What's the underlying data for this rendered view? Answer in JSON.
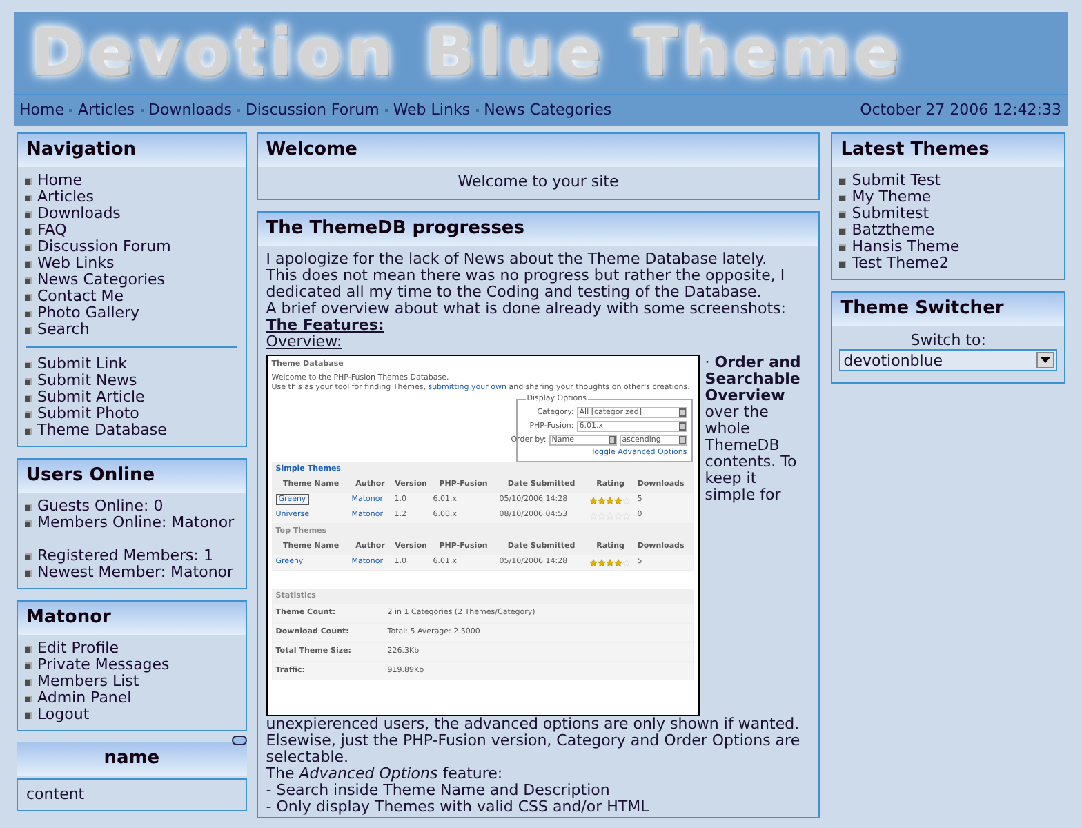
{
  "header": {
    "title": "Devotion Blue Theme",
    "nav": [
      "Home",
      "Articles",
      "Downloads",
      "Discussion Forum",
      "Web Links",
      "News Categories"
    ],
    "datetime": "October 27 2006 12:42:33"
  },
  "left_sidebar": [
    {
      "kind": "menu",
      "title": "Navigation",
      "groups": [
        [
          "Home",
          "Articles",
          "Downloads",
          "FAQ",
          "Discussion Forum",
          "Web Links",
          "News Categories",
          "Contact Me",
          "Photo Gallery",
          "Search"
        ],
        [
          "Submit Link",
          "Submit News",
          "Submit Article",
          "Submit Photo",
          "Theme Database"
        ]
      ],
      "divider": true
    },
    {
      "kind": "menu",
      "title": "Users Online",
      "groups": [
        [
          "Guests Online: 0",
          "Members Online: Matonor"
        ],
        [
          "Registered Members: 1",
          "Newest Member: Matonor"
        ]
      ],
      "divider": false
    },
    {
      "kind": "menu",
      "title": "Matonor",
      "groups": [
        [
          "Edit Profile",
          "Private Messages",
          "Members List",
          "Admin Panel",
          "Logout"
        ]
      ]
    },
    {
      "kind": "collapsible",
      "title": "name",
      "content": "content"
    }
  ],
  "welcome": {
    "title": "Welcome",
    "text": "Welcome to your site"
  },
  "news": {
    "title": "The ThemeDB progresses",
    "intro": [
      "I apologize for the lack of News about the Theme Database lately.",
      "This does not mean there was no progress but rather the opposite, I dedicated all my time to the Coding and testing of the Database.",
      "A brief overview about what is done already with some screenshots:"
    ],
    "features_heading": "The Features:",
    "overview_heading": "Overview:",
    "screenshot": {
      "title": "Theme Database",
      "welcome": "Welcome to the PHP-Fusion Themes Database.",
      "use_before": "Use this as your tool for finding Themes,",
      "use_link": "submitting your own",
      "use_after": "and sharing your thoughts on other's creations.",
      "options": {
        "legend": "Display Options",
        "fields": [
          {
            "label": "Category:",
            "values": [
              "All [categorized]"
            ]
          },
          {
            "label": "PHP-Fusion:",
            "values": [
              "6.01.x"
            ]
          },
          {
            "label": "Order by:",
            "values": [
              "Name",
              "ascending"
            ]
          }
        ],
        "toggle": "Toggle Advanced Options"
      },
      "tables": [
        {
          "title": "Simple Themes",
          "title_link": true,
          "columns": [
            "Theme Name",
            "Author",
            "Version",
            "PHP-Fusion",
            "Date Submitted",
            "Rating",
            "Downloads"
          ],
          "rows": [
            {
              "name": "Greeny",
              "focused": true,
              "author": "Matonor",
              "version": "1.0",
              "fusion": "6.01.x",
              "date": "05/10/2006 14:28",
              "stars": 4,
              "downloads": "5"
            },
            {
              "name": "Universe",
              "focused": false,
              "author": "Matonor",
              "version": "1.2",
              "fusion": "6.00.x",
              "date": "08/10/2006 04:53",
              "stars": 0,
              "downloads": "0"
            }
          ]
        },
        {
          "title": "Top Themes",
          "title_link": false,
          "columns": [
            "Theme Name",
            "Author",
            "Version",
            "PHP-Fusion",
            "Date Submitted",
            "Rating",
            "Downloads"
          ],
          "rows": [
            {
              "name": "Greeny",
              "focused": false,
              "author": "Matonor",
              "version": "1.0",
              "fusion": "6.01.x",
              "date": "05/10/2006 14:28",
              "stars": 4,
              "downloads": "5"
            }
          ]
        }
      ],
      "statistics": {
        "title": "Statistics",
        "rows": [
          {
            "label": "Theme Count:",
            "value": "2 in 1 Categories (2 Themes/Category)"
          },
          {
            "label": "Download Count:",
            "value": "Total: 5 Average: 2.5000"
          },
          {
            "label": "Total Theme Size:",
            "value": "226.3Kb"
          },
          {
            "label": "Traffic:",
            "value": "919.89Kb"
          }
        ]
      }
    },
    "float_text": "· **Order and Searchable Overview** over the whole ThemeDB contents. To keep it simple for",
    "after_text": "unexpierenced users, the advanced options are only shown if wanted. Elsewise, just the PHP-Fusion version, Category and Order Options are selectable.",
    "lines": [
      "The *Advanced Options* feature:",
      "- Search inside Theme Name and Description",
      "- Only display Themes with valid CSS and/or HTML"
    ]
  },
  "right_sidebar": [
    {
      "kind": "menu",
      "title": "Latest Themes",
      "groups": [
        [
          "Submit Test",
          "My Theme",
          "Submitest",
          "Batztheme",
          "Hansis Theme",
          "Test Theme2"
        ]
      ]
    },
    {
      "kind": "switcher",
      "title": "Theme Switcher",
      "label": "Switch to:",
      "value": "devotionblue"
    }
  ]
}
